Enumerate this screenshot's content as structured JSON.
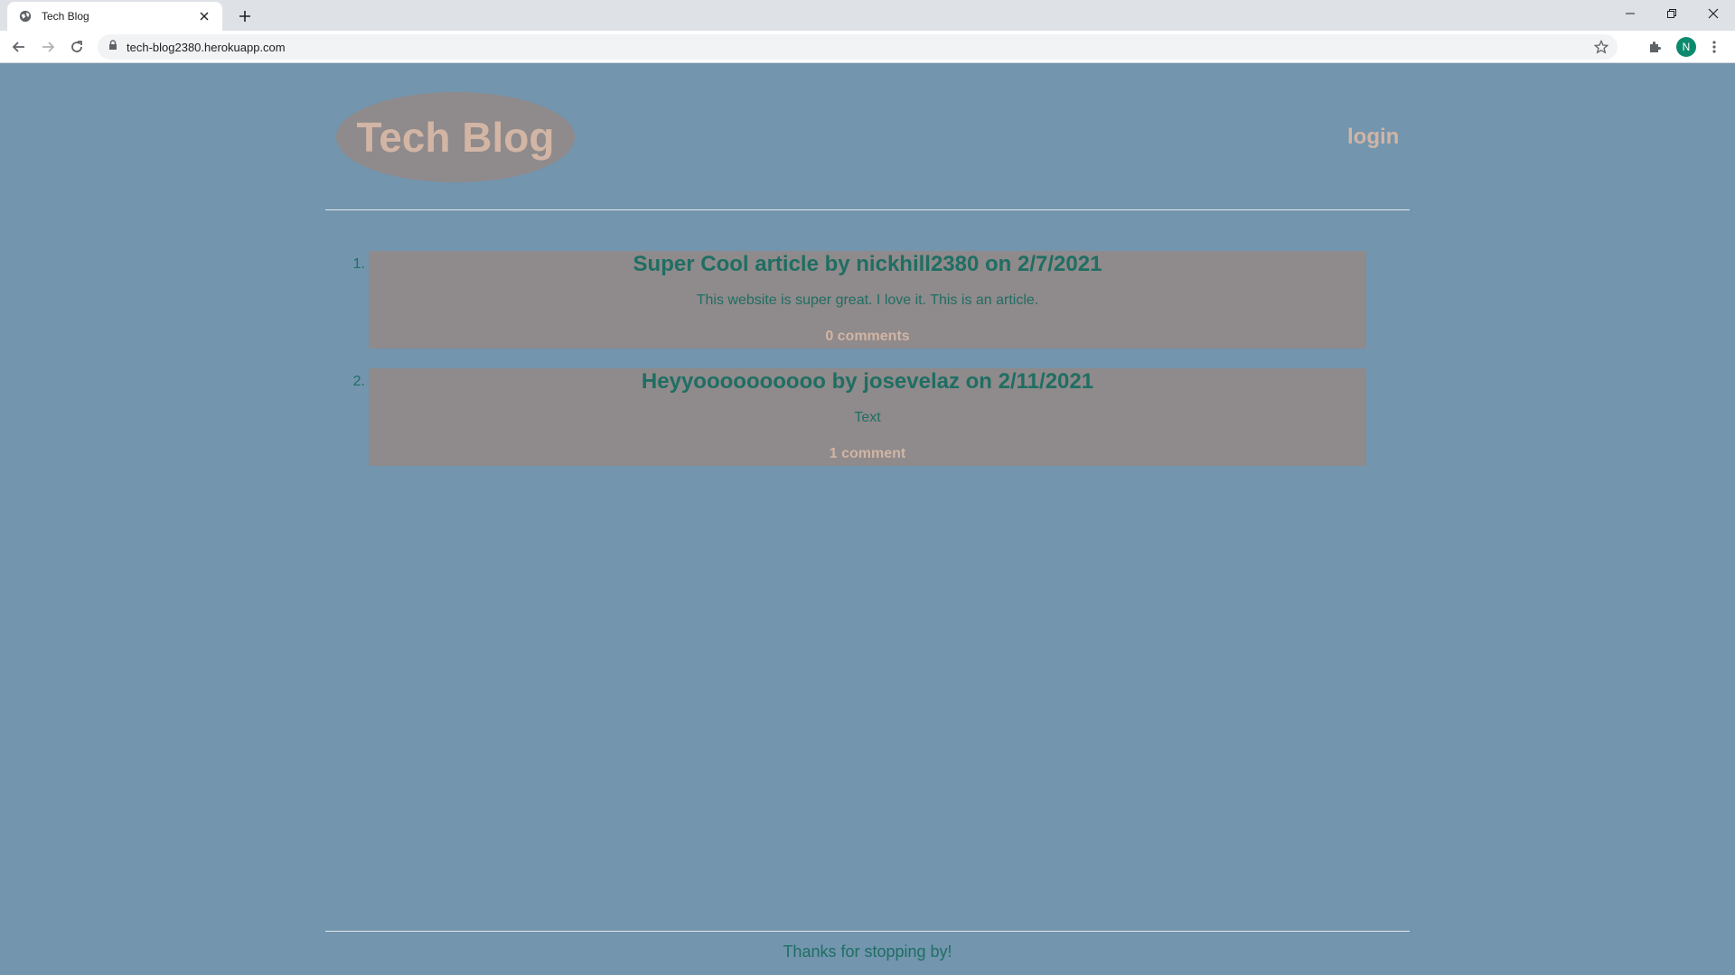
{
  "browser": {
    "tab_title": "Tech Blog",
    "url": "tech-blog2380.herokuapp.com",
    "profile_initial": "N"
  },
  "header": {
    "logo_text": "Tech Blog",
    "login_label": "login"
  },
  "posts": [
    {
      "number": "1.",
      "title": "Super Cool article by nickhill2380 on 2/7/2021",
      "body": "This website is super great. I love it. This is an article.",
      "comments": "0 comments"
    },
    {
      "number": "2.",
      "title": "Heyyoooooooooo by josevelaz on 2/11/2021",
      "body": "Text",
      "comments": "1 comment"
    }
  ],
  "footer": {
    "text": "Thanks for stopping by!"
  },
  "colors": {
    "page_background": "#7395ae",
    "card_background": "#8f8a8b",
    "accent_text": "#d2b5a4",
    "body_text": "#1f6e63"
  }
}
